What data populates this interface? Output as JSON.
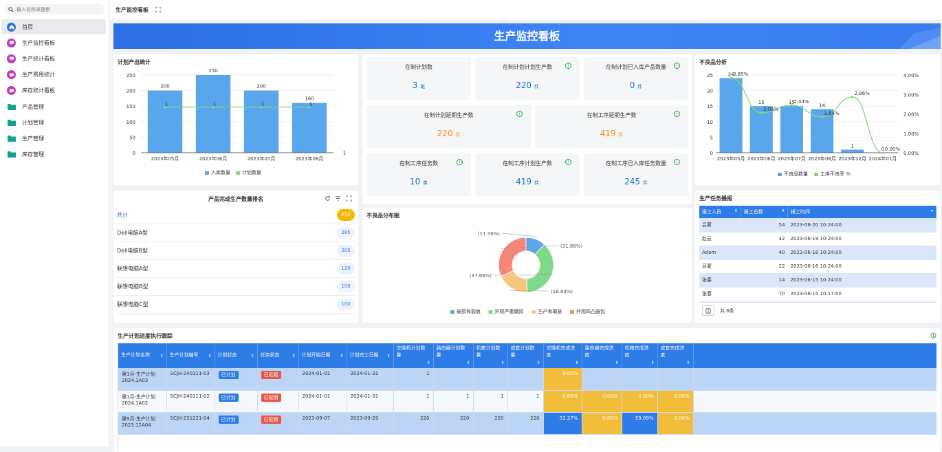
{
  "search": {
    "placeholder": "输入名称来搜索"
  },
  "sidebar": {
    "items": [
      {
        "label": "首页",
        "icon": "home-icon"
      },
      {
        "label": "生产监控看板",
        "icon": "chat-icon"
      },
      {
        "label": "生产统计看板",
        "icon": "chat-icon"
      },
      {
        "label": "生产费用统计",
        "icon": "chat-icon"
      },
      {
        "label": "库存统计看板",
        "icon": "chat-icon"
      },
      {
        "label": "产品管理",
        "icon": "folder-icon"
      },
      {
        "label": "计划管理",
        "icon": "folder-icon"
      },
      {
        "label": "生产管理",
        "icon": "folder-icon"
      },
      {
        "label": "库存管理",
        "icon": "folder-icon"
      }
    ]
  },
  "topbar": {
    "title": "生产监控看板"
  },
  "banner": {
    "title": "生产监控看板"
  },
  "plan_output": {
    "title": "计划产出统计"
  },
  "kpis": [
    {
      "label": "在制计划数",
      "value": "3",
      "unit": "笔"
    },
    {
      "label": "在制计划计划生产数",
      "value": "220",
      "unit": "件"
    },
    {
      "label": "在制计划已入库产品数量",
      "value": "0",
      "unit": "件"
    },
    {
      "label": "在制计划延期生产数",
      "value": "220",
      "unit": "件"
    },
    {
      "label": "在制工序延期生产数",
      "value": "419",
      "unit": "件"
    },
    {
      "label": "在制工序任务数",
      "value": "10",
      "unit": "单"
    },
    {
      "label": "在制工序计划生产数",
      "value": "419",
      "unit": "件"
    },
    {
      "label": "在制工序已入库任务数量",
      "value": "245",
      "unit": "件"
    }
  ],
  "defect_analysis": {
    "title": "不良品分析"
  },
  "ranking": {
    "title": "产品完成生产数量排名",
    "rows": [
      {
        "name": "共计",
        "value": "810"
      },
      {
        "name": "Dell电脑A型",
        "value": "285"
      },
      {
        "name": "Dell电脑B型",
        "value": "205"
      },
      {
        "name": "联想电脑A型",
        "value": "120"
      },
      {
        "name": "联想电脑B型",
        "value": "100"
      },
      {
        "name": "联想电脑C型",
        "value": "100"
      }
    ]
  },
  "defect_dist": {
    "title": "不良品分布图"
  },
  "task_feed": {
    "title": "生产任务播报",
    "headers": [
      "报工人员",
      "报工总数",
      "报工时间"
    ],
    "rows": [
      {
        "person": "吕蒙",
        "count": "54",
        "time": "2023-06-20 10:24:00"
      },
      {
        "person": "赵云",
        "count": "42",
        "time": "2023-06-19 10:24:00"
      },
      {
        "person": "Adam",
        "count": "40",
        "time": "2023-06-18 10:24:00"
      },
      {
        "person": "吕蒙",
        "count": "22",
        "time": "2023-06-16 10:24:00"
      },
      {
        "person": "张春",
        "count": "14",
        "time": "2023-06-15 10:24:00"
      },
      {
        "person": "张春",
        "count": "70",
        "time": "2023-06-15 10:17:00"
      }
    ],
    "footer": "共 6条"
  },
  "tracking": {
    "title": "生产计划进度执行跟踪",
    "headers": [
      "生产计划名称",
      "生产计划编号",
      "计划状态",
      "任务状态",
      "计划开始日期",
      "计划完工日期",
      "交换机计划数量",
      "路由器计划数量",
      "机箱计划数量",
      "成套计划数量",
      "交换机完成进度",
      "路由器完成进度",
      "机箱完成进度",
      "成套完成进度"
    ],
    "rows": [
      {
        "name": "第1月-生产计划",
        "code_line": "2024.1A03",
        "no": "SCJH-240111-03",
        "plan_status": "已计划",
        "task_status": "已延期",
        "start": "2024-01-01",
        "end": "2024-01-31",
        "q1": "1",
        "q2": "",
        "q3": "",
        "q4": "",
        "p1": "0.00%",
        "p2": "",
        "p3": "",
        "p4": ""
      },
      {
        "name": "第1月-生产计划",
        "code_line": "2024.1A02",
        "no": "SCJH-240111-02",
        "plan_status": "已计划",
        "task_status": "已延期",
        "start": "2024-01-01",
        "end": "2024-01-31",
        "q1": "1",
        "q2": "1",
        "q3": "1",
        "q4": "1",
        "p1": "0.00%",
        "p2": "0.00%",
        "p3": "0.00%",
        "p4": "0.00%"
      },
      {
        "name": "第9月-生产计划",
        "code_line": "2023.12A04",
        "no": "SCJH-231221-04",
        "plan_status": "已计划",
        "task_status": "已延期",
        "start": "2023-09-07",
        "end": "2023-09-29",
        "q1": "220",
        "q2": "220",
        "q3": "220",
        "q4": "220",
        "p1": "52.27%",
        "p2": "0.00%",
        "p3": "59.09%",
        "p4": "0.00%"
      }
    ]
  },
  "chart_data": [
    {
      "type": "bar",
      "title": "计划产出统计",
      "categories": [
        "2023年05月",
        "2023年06月",
        "2023年07月",
        "2023年08月"
      ],
      "series": [
        {
          "name": "入库数量",
          "type": "bar",
          "values": [
            200,
            250,
            200,
            160
          ],
          "color": "#5aa6ec"
        },
        {
          "name": "计划数量",
          "type": "line",
          "values": [
            1,
            1,
            1,
            1
          ],
          "color": "#86d67a"
        }
      ],
      "yticks": [
        0,
        50,
        100,
        150,
        200,
        250
      ],
      "right_axis_label": "1",
      "ylim": [
        0,
        250
      ],
      "legend": "bottom"
    },
    {
      "type": "bar",
      "title": "不良品分析",
      "categories": [
        "2023年05月",
        "2023年06月",
        "2023年07月",
        "2023年08月",
        "2023年12月",
        "2024年01月"
      ],
      "series": [
        {
          "name": "不良品数量",
          "type": "bar",
          "values": [
            24,
            15,
            15,
            14,
            1,
            0
          ],
          "color": "#5aa6ec"
        },
        {
          "name": "工序不良率 %",
          "type": "line",
          "values": [
            3.85,
            2.05,
            2.44,
            1.84,
            2.86,
            0.0
          ],
          "labels": [
            "3.85%",
            "2.05%",
            "2.44%",
            "1.84%",
            "2.86%",
            "0.00%"
          ],
          "color": "#86d67a"
        }
      ],
      "yticks": [
        0,
        5,
        10,
        15,
        20,
        25
      ],
      "y2ticks": [
        "0.00%",
        "1.00%",
        "2.00%",
        "3.00%",
        "4.00%"
      ],
      "ylim": [
        0,
        25
      ],
      "y2lim": [
        0,
        4
      ],
      "legend": "bottom"
    },
    {
      "type": "pie",
      "title": "不良品分布图",
      "categories": [
        "破损有裂痕",
        "外观严重磨损",
        "生产有瑕疵",
        "外观凹凸鼓包"
      ],
      "values": [
        11.59,
        37.68,
        18.84,
        31.88
      ],
      "labels": [
        "(11.59%)",
        "(37.68%)",
        "(18.84%)",
        "(31.88%)"
      ],
      "colors": [
        "#5aa6ec",
        "#7fd98a",
        "#f6c77d",
        "#f4867a"
      ],
      "legend": "bottom"
    }
  ]
}
